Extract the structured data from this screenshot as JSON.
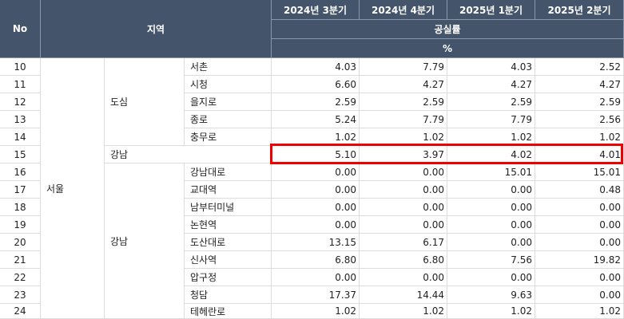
{
  "table": {
    "headers": {
      "no": "No",
      "region": "지역",
      "periods": [
        "2024년 3분기",
        "2024년 4분기",
        "2025년 1분기",
        "2025년 2분기"
      ],
      "metric": "공실률",
      "unit": "%"
    },
    "groups": {
      "city": "서울",
      "dosim": "도심",
      "gangnam_total": "강남",
      "gangnam": "강남"
    },
    "rows": [
      {
        "no": "10",
        "area": "서촌",
        "v": [
          "4.03",
          "7.79",
          "4.03",
          "2.52"
        ]
      },
      {
        "no": "11",
        "area": "시청",
        "v": [
          "6.60",
          "4.27",
          "4.27",
          "4.27"
        ]
      },
      {
        "no": "12",
        "area": "을지로",
        "v": [
          "2.59",
          "2.59",
          "2.59",
          "2.59"
        ]
      },
      {
        "no": "13",
        "area": "종로",
        "v": [
          "5.24",
          "7.79",
          "7.79",
          "2.56"
        ]
      },
      {
        "no": "14",
        "area": "충무로",
        "v": [
          "1.02",
          "1.02",
          "1.02",
          "1.02"
        ]
      },
      {
        "no": "15",
        "area": "",
        "v": [
          "5.10",
          "3.97",
          "4.02",
          "4.01"
        ]
      },
      {
        "no": "16",
        "area": "강남대로",
        "v": [
          "0.00",
          "0.00",
          "15.01",
          "15.01"
        ]
      },
      {
        "no": "17",
        "area": "교대역",
        "v": [
          "0.00",
          "0.00",
          "0.00",
          "0.48"
        ]
      },
      {
        "no": "18",
        "area": "남부터미널",
        "v": [
          "0.00",
          "0.00",
          "0.00",
          "0.00"
        ]
      },
      {
        "no": "19",
        "area": "논현역",
        "v": [
          "0.00",
          "0.00",
          "0.00",
          "0.00"
        ]
      },
      {
        "no": "20",
        "area": "도산대로",
        "v": [
          "13.15",
          "6.17",
          "0.00",
          "0.00"
        ]
      },
      {
        "no": "21",
        "area": "신사역",
        "v": [
          "6.80",
          "6.80",
          "7.56",
          "19.82"
        ]
      },
      {
        "no": "22",
        "area": "압구정",
        "v": [
          "0.00",
          "0.00",
          "0.00",
          "0.00"
        ]
      },
      {
        "no": "23",
        "area": "청담",
        "v": [
          "17.37",
          "14.44",
          "9.63",
          "0.00"
        ]
      },
      {
        "no": "24",
        "area": "테헤란로",
        "v": [
          "1.02",
          "1.02",
          "1.02",
          "1.02"
        ]
      }
    ],
    "highlight_row_no": "15",
    "colors": {
      "header_bg": "#44546A",
      "header_text": "#FFFFFF",
      "highlight_border": "#EE0000",
      "grid": "#DCDCDC"
    }
  }
}
